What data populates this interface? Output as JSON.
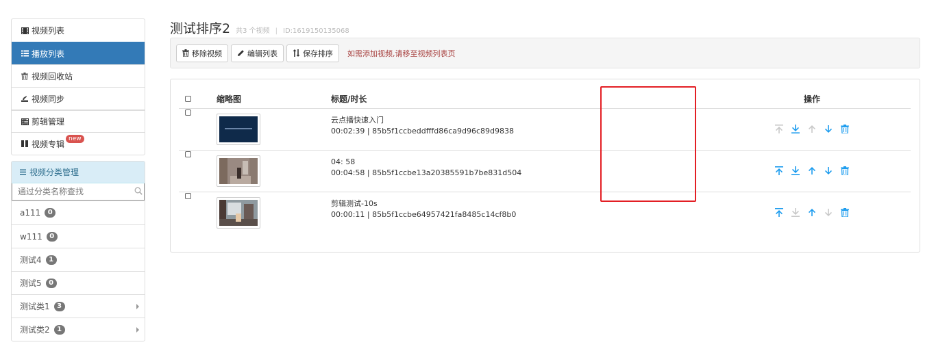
{
  "sidebar": {
    "nav": [
      {
        "label": "视频列表",
        "icon": "film-icon",
        "active": false
      },
      {
        "label": "播放列表",
        "icon": "list-icon",
        "active": true
      },
      {
        "label": "视频回收站",
        "icon": "trash-icon",
        "active": false
      },
      {
        "label": "视频同步",
        "icon": "sync-icon",
        "active": false
      },
      {
        "label": "剪辑管理",
        "icon": "tasks-icon",
        "active": false
      },
      {
        "label": "视频专辑",
        "icon": "columns-icon",
        "active": false,
        "badge": "new"
      }
    ],
    "category": {
      "title": "视频分类管理",
      "search_placeholder": "通过分类名称查找",
      "items": [
        {
          "name": "a111",
          "count": "0",
          "has_children": false
        },
        {
          "name": "w111",
          "count": "0",
          "has_children": false
        },
        {
          "name": "测试4",
          "count": "1",
          "has_children": false
        },
        {
          "name": "测试5",
          "count": "0",
          "has_children": false
        },
        {
          "name": "测试类1",
          "count": "3",
          "has_children": true
        },
        {
          "name": "测试类2",
          "count": "1",
          "has_children": true
        }
      ]
    }
  },
  "main": {
    "title": "测试排序2",
    "video_count": "共3 个视频",
    "separator": "|",
    "id_text": "ID:1619150135068",
    "toolbar": {
      "remove_label": "移除视频",
      "edit_label": "编辑列表",
      "save_label": "保存排序",
      "hint": "如需添加视频,请移至视频列表页"
    },
    "table": {
      "headers": {
        "thumb": "缩略图",
        "title": "标题/时长",
        "ops": "操作"
      },
      "rows": [
        {
          "title": "云点播快速入门",
          "meta": "00:02:39 | 85b5f1ccbeddfffd86ca9d96c89d9838",
          "thumb": "blue",
          "ops": {
            "top": false,
            "bottom": true,
            "up": false,
            "down": true,
            "del": true
          }
        },
        {
          "title": "04: 58",
          "meta": "00:04:58 | 85b5f1ccbe13a20385591b7be831d504",
          "thumb": "hall",
          "ops": {
            "top": true,
            "bottom": true,
            "up": true,
            "down": true,
            "del": true
          }
        },
        {
          "title": "剪辑测试-10s",
          "meta": "00:00:11 | 85b5f1ccbe64957421fa8485c14cf8b0",
          "thumb": "room",
          "ops": {
            "top": true,
            "bottom": false,
            "up": true,
            "down": false,
            "del": true
          }
        }
      ]
    },
    "colors": {
      "primary": "#337ab7",
      "op_active": "#1a9bee",
      "op_disabled": "#c8c8c8",
      "highlight": "#e31e24",
      "hint": "#a94442"
    }
  }
}
